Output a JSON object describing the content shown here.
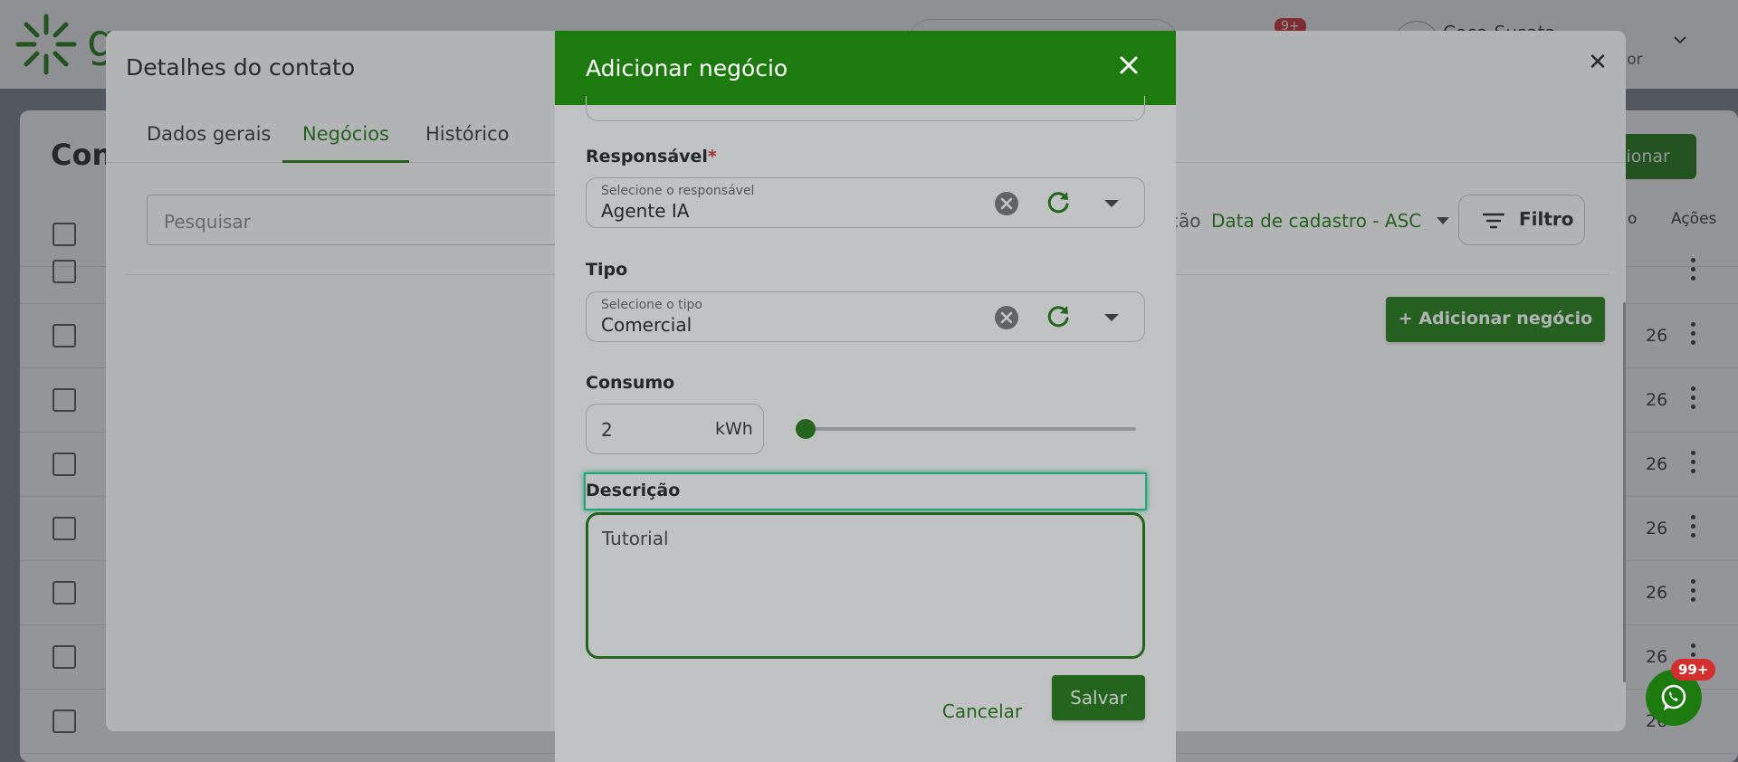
{
  "app": {
    "header": {
      "logo_letter": "g",
      "notifications_badge": "9+",
      "user_name": "Coca-Susata",
      "user_role": "ador"
    },
    "page_title": "Cont",
    "primary_button_label": "cionar",
    "columns": [
      "o",
      "Ações"
    ],
    "rows": [
      "",
      "26",
      "26",
      "26",
      "26",
      "26",
      "26",
      "26"
    ]
  },
  "details_modal": {
    "title": "Detalhes do contato",
    "close_label": "✕",
    "tabs": [
      "Dados gerais",
      "Negócios",
      "Histórico"
    ],
    "active_tab": "Negócios",
    "search_placeholder": "Pesquisar",
    "ordering_label": "ção",
    "ordering_value": "Data de cadastro - ASC",
    "filter_label": "Filtro",
    "add_business_label": "+ Adicionar negócio"
  },
  "add_business_dialog": {
    "title": "Adicionar negócio",
    "responsible": {
      "label": "Responsável",
      "required_mark": "*",
      "placeholder": "Selecione o responsável",
      "value": "Agente IA"
    },
    "type": {
      "label": "Tipo",
      "placeholder": "Selecione o tipo",
      "value": "Comercial"
    },
    "consumption": {
      "label": "Consumo",
      "value": "2",
      "unit": "kWh",
      "slider_level": 0.01
    },
    "description": {
      "label": "Descrição",
      "value": "Tutorial"
    },
    "cancel_label": "Cancelar",
    "save_label": "Salvar"
  },
  "whatsapp": {
    "badge": "99+"
  },
  "colors": {
    "brand_green": "#1d7a0f",
    "focus_outline": "#21d48a",
    "badge_red": "#d32f2f"
  }
}
